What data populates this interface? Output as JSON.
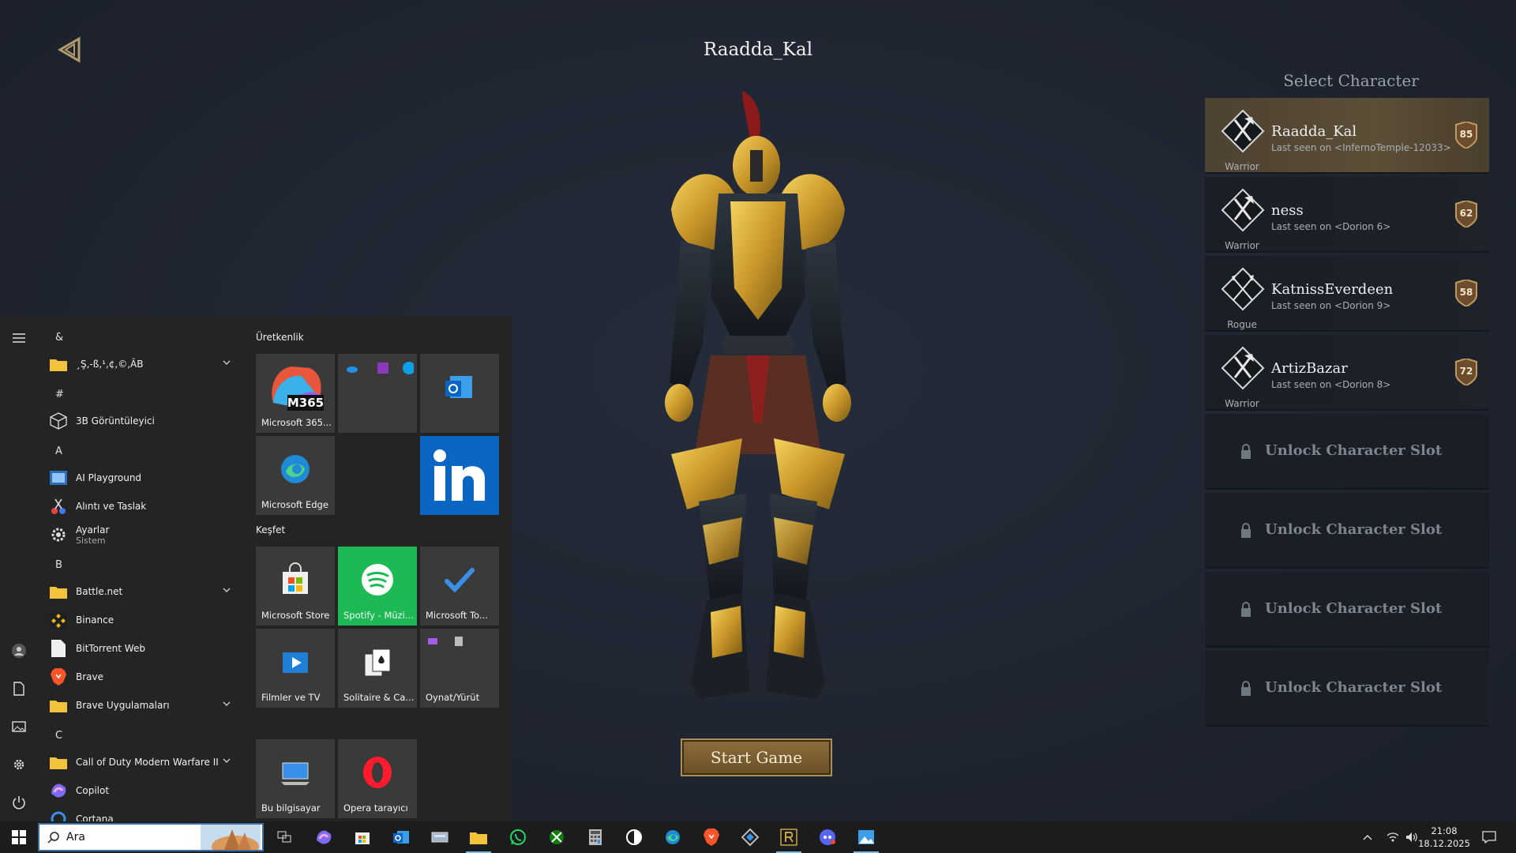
{
  "game": {
    "character_title": "Raadda_Kal",
    "select_title": "Select Character",
    "start_button": "Start Game",
    "characters": [
      {
        "name": "Raadda_Kal",
        "last_seen": "Last seen on <InfernoTemple-12033>",
        "class": "Warrior",
        "level": "85",
        "selected": true
      },
      {
        "name": "ness",
        "last_seen": "Last seen on <Dorion 6>",
        "class": "Warrior",
        "level": "62",
        "selected": false
      },
      {
        "name": "KatnissEverdeen",
        "last_seen": "Last seen on <Dorion 9>",
        "class": "Rogue",
        "level": "58",
        "selected": false
      },
      {
        "name": "ArtizBazar",
        "last_seen": "Last seen on <Dorion 8>",
        "class": "Warrior",
        "level": "72",
        "selected": false
      }
    ],
    "locked_slot_label": "Unlock Character Slot",
    "locked_slots": 4
  },
  "start_menu": {
    "letters": {
      "amp": "&",
      "hash": "#",
      "a": "A",
      "b": "B",
      "c": "C"
    },
    "apps": {
      "garbled_folder": "¸Ş,-ß,¹,¢,©,ÂB",
      "viewer3d": "3B Görüntüleyici",
      "ai_playground": "AI Playground",
      "snipping": "Alıntı ve Taslak",
      "settings": "Ayarlar",
      "settings_sub": "Sistem",
      "battlenet": "Battle.net",
      "binance": "Binance",
      "bittorrent": "BitTorrent Web",
      "brave": "Brave",
      "brave_apps": "Brave Uygulamaları",
      "cod": "Call of Duty Modern Warfare II",
      "copilot": "Copilot",
      "cortana": "Cortana"
    },
    "groups": {
      "productivity": "Üretkenlik",
      "explore": "Keşfet"
    },
    "tiles": {
      "m365": "Microsoft 365...",
      "m365_badge": "M365",
      "edge": "Microsoft Edge",
      "store": "Microsoft Store",
      "spotify": "Spotify - Müzi...",
      "todo": "Microsoft To...",
      "movies": "Filmler ve TV",
      "solitaire": "Solitaire & Ca...",
      "play": "Oynat/Yürüt",
      "thispc": "Bu bilgisayar",
      "opera": "Opera tarayıcı"
    }
  },
  "taskbar": {
    "search_value": "Ara",
    "time": "21:08",
    "date": "18.12.2025"
  },
  "colors": {
    "accent_gold": "#8c6d3c",
    "spotify_green": "#1db954",
    "linkedin_blue": "#0a66c2"
  }
}
